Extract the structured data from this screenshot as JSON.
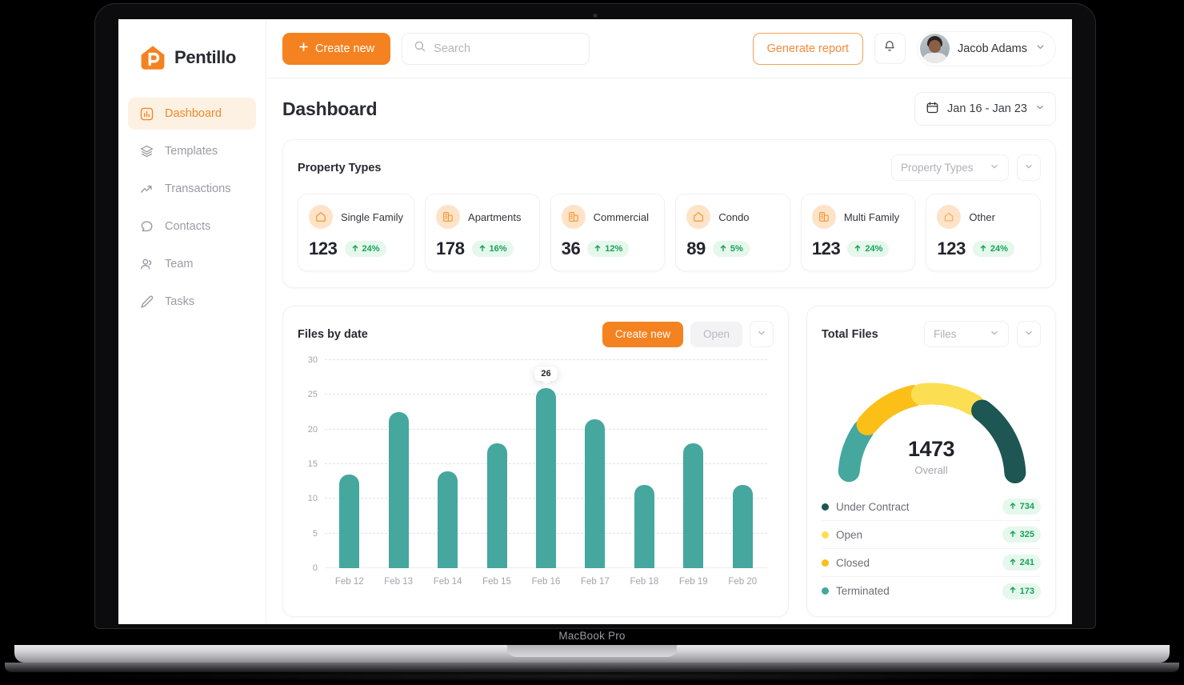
{
  "device": {
    "label": "MacBook Pro"
  },
  "brand": {
    "name": "Pentillo",
    "logo_icon": "house-p-logo-icon",
    "accent": "#F58220"
  },
  "sidebar": {
    "items": [
      {
        "label": "Dashboard",
        "icon": "chart-bar-square-icon",
        "active": true
      },
      {
        "label": "Templates",
        "icon": "layers-icon",
        "active": false
      },
      {
        "label": "Transactions",
        "icon": "trending-up-icon",
        "active": false
      },
      {
        "label": "Contacts",
        "icon": "chat-bubble-icon",
        "active": false
      },
      {
        "label": "Team",
        "icon": "users-icon",
        "active": false
      },
      {
        "label": "Tasks",
        "icon": "pencil-icon",
        "active": false
      }
    ]
  },
  "topbar": {
    "create_new_label": "Create new",
    "create_new_icon": "plus-icon",
    "search": {
      "placeholder": "Search",
      "value": "",
      "icon": "search-icon"
    },
    "generate_report_label": "Generate report",
    "notifications_icon": "bell-icon",
    "user": {
      "name": "Jacob Adams",
      "avatar_icon": "avatar",
      "chevron_icon": "chevron-down-icon"
    }
  },
  "page": {
    "title": "Dashboard",
    "date_range": {
      "value": "Jan 16 - Jan 23",
      "icon": "calendar-icon",
      "chevron_icon": "chevron-down-icon"
    }
  },
  "property_types": {
    "title": "Property Types",
    "filter": {
      "value": "Property Types",
      "chevron_icon": "chevron-down-icon"
    },
    "more_icon": "chevron-down-icon",
    "cards": [
      {
        "label": "Single Family",
        "value": "123",
        "delta": "24%",
        "trend_icon": "arrow-up-icon",
        "icon": "home-icon"
      },
      {
        "label": "Apartments",
        "value": "178",
        "delta": "16%",
        "trend_icon": "arrow-up-icon",
        "icon": "building-icon"
      },
      {
        "label": "Commercial",
        "value": "36",
        "delta": "12%",
        "trend_icon": "arrow-up-icon",
        "icon": "building-icon"
      },
      {
        "label": "Condo",
        "value": "89",
        "delta": "5%",
        "trend_icon": "arrow-up-icon",
        "icon": "home-icon"
      },
      {
        "label": "Multi Family",
        "value": "123",
        "delta": "24%",
        "trend_icon": "arrow-up-icon",
        "icon": "building-icon"
      },
      {
        "label": "Other",
        "value": "123",
        "delta": "24%",
        "trend_icon": "arrow-up-icon",
        "icon": "pentagon-home-icon"
      }
    ]
  },
  "files_by_date": {
    "title": "Files by date",
    "create_new_label": "Create new",
    "open_label": "Open",
    "more_icon": "chevron-down-icon"
  },
  "total_files": {
    "title": "Total Files",
    "filter": {
      "value": "Files",
      "chevron_icon": "chevron-down-icon"
    },
    "more_icon": "chevron-down-icon",
    "gauge_value": "1473",
    "gauge_caption": "Overall",
    "legend": [
      {
        "label": "Under Contract",
        "value": "734",
        "color": "#1D5652",
        "trend_icon": "arrow-up-icon"
      },
      {
        "label": "Open",
        "value": "325",
        "color": "#FBDE52",
        "trend_icon": "arrow-up-icon"
      },
      {
        "label": "Closed",
        "value": "241",
        "color": "#FBBF18",
        "trend_icon": "arrow-up-icon"
      },
      {
        "label": "Terminated",
        "value": "173",
        "color": "#45A79E",
        "trend_icon": "arrow-up-icon"
      }
    ]
  },
  "chart_data": [
    {
      "type": "bar",
      "title": "Files by date",
      "categories": [
        "Feb 12",
        "Feb 13",
        "Feb 14",
        "Feb 15",
        "Feb 16",
        "Feb 17",
        "Feb 18",
        "Feb 19",
        "Feb 20"
      ],
      "values": [
        13.5,
        22.5,
        14,
        18,
        26,
        21.5,
        12,
        18,
        12
      ],
      "highlight_index": 4,
      "highlight_label": "26",
      "xlabel": "",
      "ylabel": "",
      "ylim": [
        0,
        30
      ],
      "yticks": [
        0,
        5,
        10,
        15,
        20,
        25,
        30
      ],
      "grid": true,
      "series_color": "#45A79E",
      "legend": "none"
    },
    {
      "type": "pie",
      "title": "Total Files",
      "subtitle": "Overall",
      "center_value": 1473,
      "labels": [
        "Under Contract",
        "Open",
        "Closed",
        "Terminated"
      ],
      "values": [
        734,
        325,
        241,
        173
      ],
      "colors": [
        "#1D5652",
        "#FBDE52",
        "#FBBF18",
        "#45A79E"
      ],
      "legend": "bottom",
      "note": "rendered as a segmented semicircular gauge"
    }
  ]
}
